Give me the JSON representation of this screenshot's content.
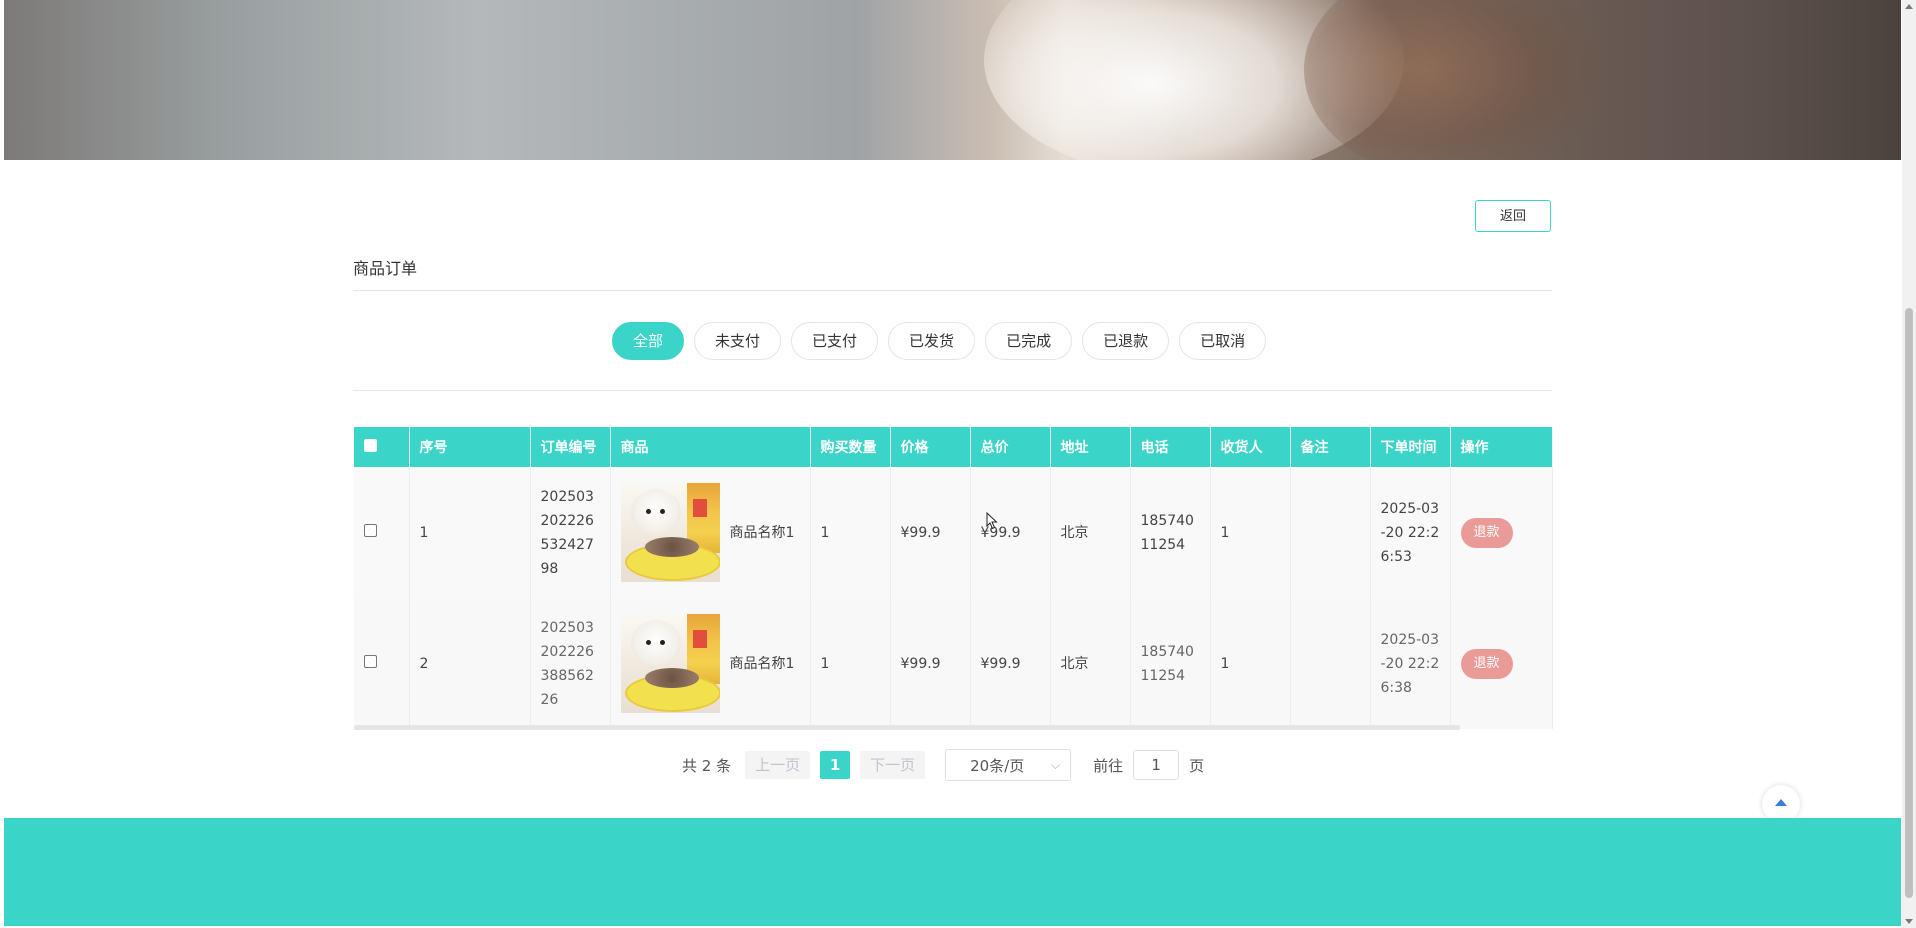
{
  "header": {
    "back_label": "返回"
  },
  "page": {
    "title": "商品订单"
  },
  "tabs": [
    {
      "label": "全部",
      "active": true
    },
    {
      "label": "未支付"
    },
    {
      "label": "已支付"
    },
    {
      "label": "已发货"
    },
    {
      "label": "已完成"
    },
    {
      "label": "已退款"
    },
    {
      "label": "已取消"
    }
  ],
  "table": {
    "columns": [
      "序号",
      "订单编号",
      "商品",
      "购买数量",
      "价格",
      "总价",
      "地址",
      "电话",
      "收货人",
      "备注",
      "下单时间",
      "操作"
    ],
    "rows": [
      {
        "index": "1",
        "order_no": "20250320222653242798",
        "product_name": "商品名称1",
        "quantity": "1",
        "price": "¥99.9",
        "total": "¥99.9",
        "address": "北京",
        "phone": "18574011254",
        "receiver": "1",
        "note": "",
        "order_time": "2025-03-20 22:26:53",
        "action": "退款"
      },
      {
        "index": "2",
        "order_no": "20250320222638856226",
        "product_name": "商品名称1",
        "quantity": "1",
        "price": "¥99.9",
        "total": "¥99.9",
        "address": "北京",
        "phone": "18574011254",
        "receiver": "1",
        "note": "",
        "order_time": "2025-03-20 22:26:38",
        "action": "退款"
      }
    ]
  },
  "pagination": {
    "total_text": "共 2 条",
    "prev_label": "上一页",
    "current_page": "1",
    "next_label": "下一页",
    "page_size": "20条/页",
    "goto_label": "前往",
    "goto_value": "1",
    "page_unit": "页"
  },
  "colors": {
    "accent": "#3bd4c8",
    "refund": "#ea9b97"
  }
}
